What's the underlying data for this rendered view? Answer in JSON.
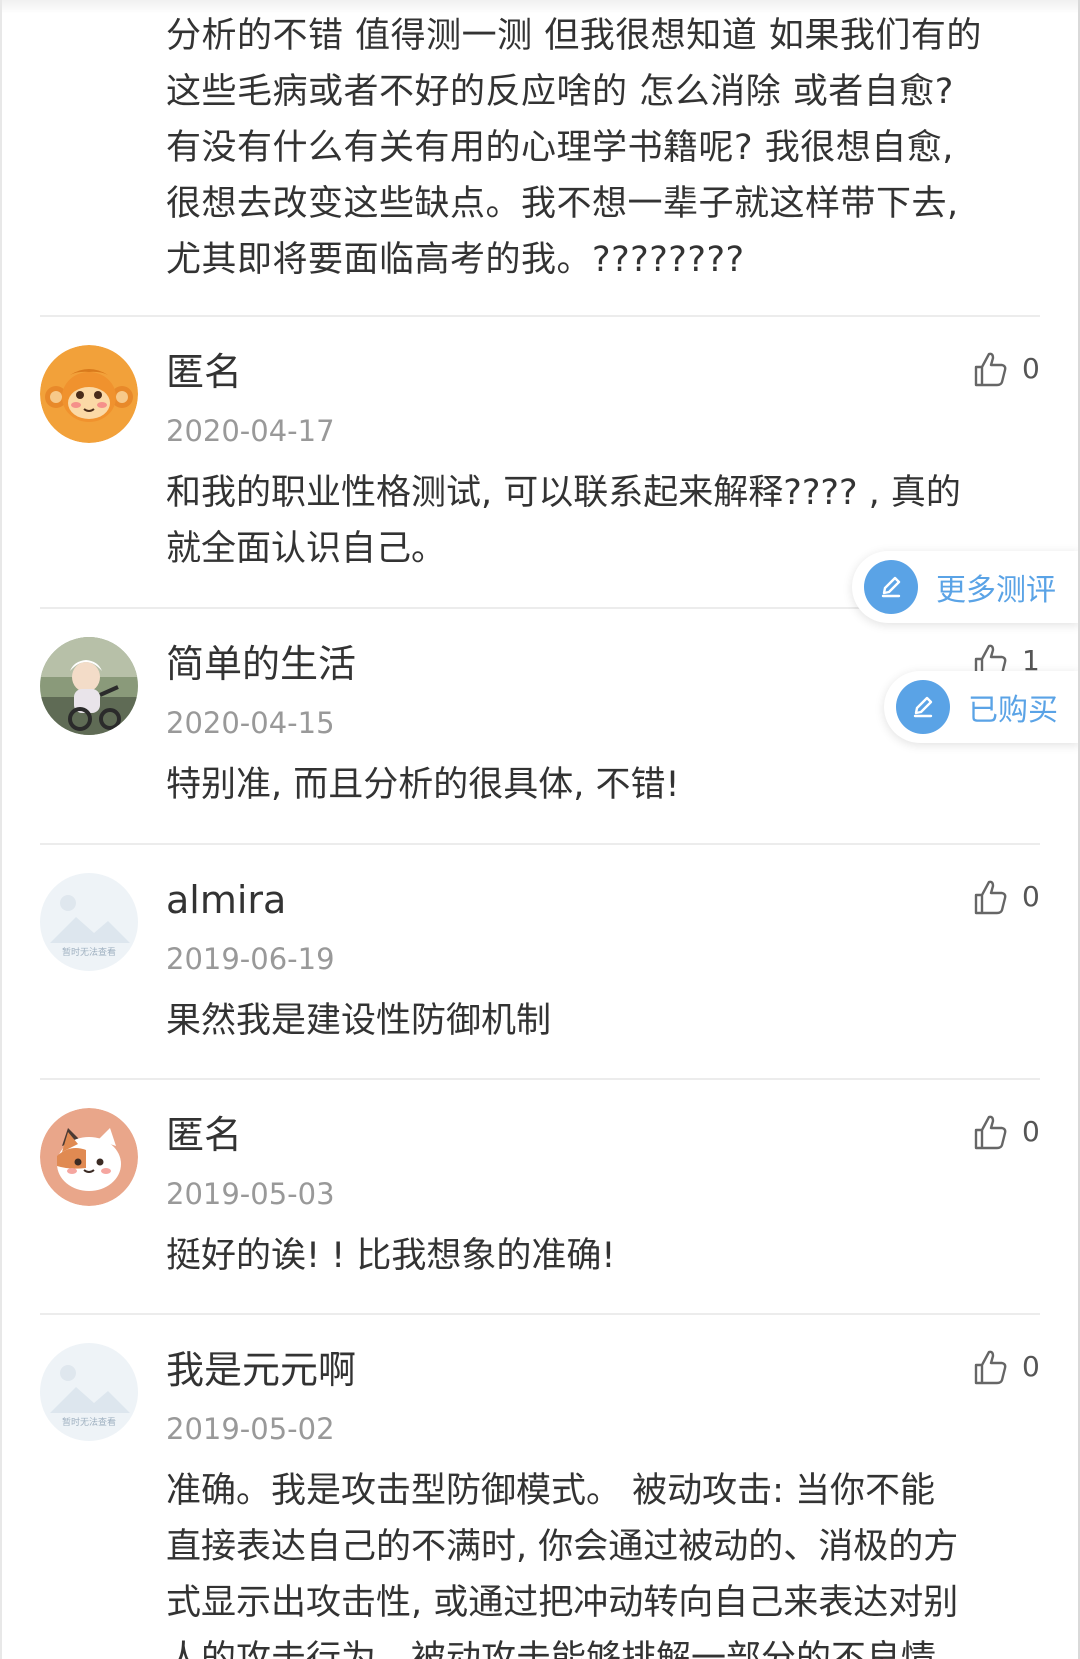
{
  "top_comment": {
    "lines": [
      "分析的不错 值得测一测 但我很想知道 如果我们有的",
      "这些毛病或者不好的反应啥的 怎么消除 或者自愈?",
      "有没有什么有关有用的心理学书籍呢? 我很想自愈,",
      "很想去改变这些缺点。我不想一辈子就这样带下去,",
      "尤其即将要面临高考的我。????????"
    ]
  },
  "comments": [
    {
      "username": "匿名",
      "date": "2020-04-17",
      "likes": "0",
      "avatar": "monkey-avatar",
      "lines": [
        "和我的职业性格测试, 可以联系起来解释???? , 真的",
        "就全面认识自己。"
      ]
    },
    {
      "username": "简单的生活",
      "date": "2020-04-15",
      "likes": "1",
      "avatar": "baby-photo-avatar",
      "lines": [
        "特别准, 而且分析的很具体, 不错!"
      ]
    },
    {
      "username": "almira",
      "date": "2019-06-19",
      "likes": "0",
      "avatar": "placeholder-avatar",
      "placeholder_text": "暂时无法查看",
      "lines": [
        "果然我是建设性防御机制"
      ]
    },
    {
      "username": "匿名",
      "date": "2019-05-03",
      "likes": "0",
      "avatar": "cat-avatar",
      "lines": [
        "挺好的诶! ! 比我想象的准确!"
      ]
    },
    {
      "username": "我是元元啊",
      "date": "2019-05-02",
      "likes": "0",
      "avatar": "placeholder-avatar",
      "placeholder_text": "暂时无法查看",
      "lines": [
        "准确。我是攻击型防御模式。 被动攻击: 当你不能",
        "直接表达自己的不满时, 你会通过被动的、消极的方",
        "式显示出攻击性, 或通过把冲动转向自己来表达对别",
        "人的攻击行为。被动攻击能够排解一部分的不良情"
      ]
    }
  ],
  "floating_buttons": {
    "more_reviews": "更多测评",
    "purchased": "已购买"
  },
  "colors": {
    "accent": "#5aa3e6",
    "text": "#333333",
    "muted": "#999999",
    "divider": "#ececec"
  }
}
